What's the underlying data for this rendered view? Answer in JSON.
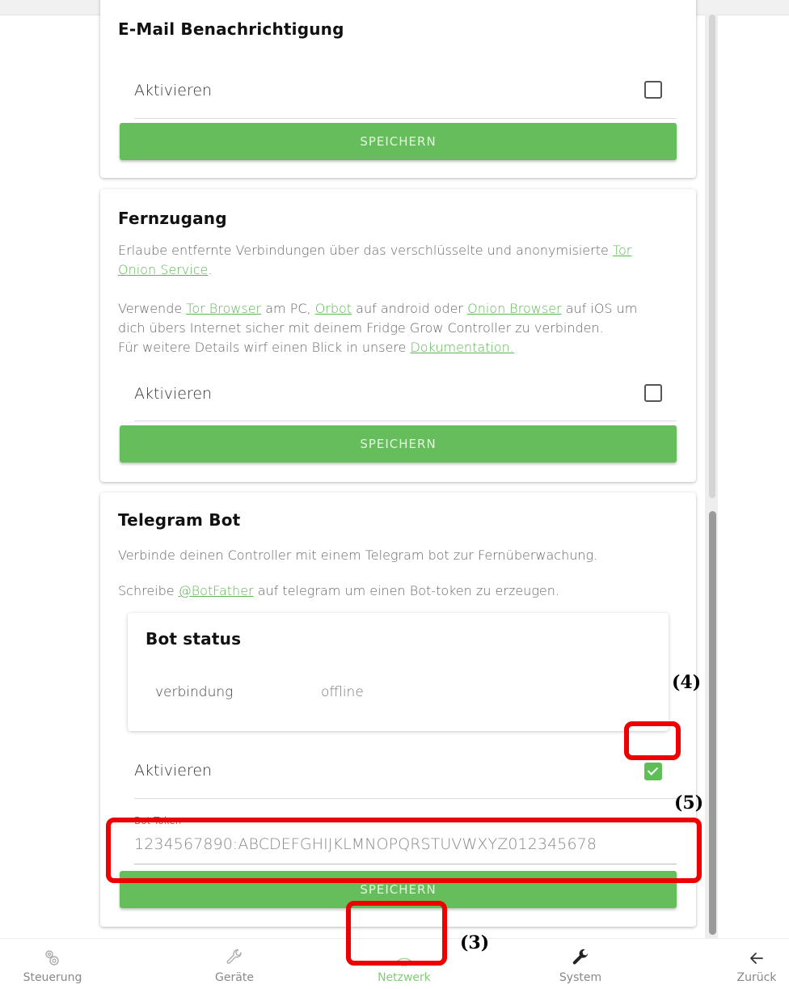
{
  "email_card": {
    "title": "E-Mail Benachrichtigung",
    "activate_label": "Aktivieren",
    "activate_checked": false,
    "save_label": "SPEICHERN"
  },
  "remote_card": {
    "title": "Fernzugang",
    "p1_text": "Erlaube entfernte Verbindungen über das verschlüsselte und anonymisierte ",
    "p1_link": "Tor Onion Service",
    "p1_end": ".",
    "p2_a": "Verwende ",
    "p2_link1": "Tor Browser",
    "p2_b": " am PC, ",
    "p2_link2": "Orbot",
    "p2_c": " auf android oder ",
    "p2_link3": "Onion Browser",
    "p2_d": " auf iOS um dich übers Internet sicher mit deinem Fridge Grow Controller zu verbinden.",
    "p3_text": "Für weitere Details wirf einen Blick in unsere ",
    "p3_link": "Dokumentation.",
    "activate_label": "Aktivieren",
    "activate_checked": false,
    "save_label": "SPEICHERN"
  },
  "telegram_card": {
    "title": "Telegram Bot",
    "p1": "Verbinde deinen Controller mit einem Telegram bot zur Fernüberwachung.",
    "p2_a": "Schreibe ",
    "p2_link": "@BotFather",
    "p2_b": " auf telegram um einen Bot-token zu erzeugen.",
    "status": {
      "title": "Bot status",
      "key": "verbindung",
      "value": "offline"
    },
    "activate_label": "Aktivieren",
    "activate_checked": true,
    "token_label": "Bot Token",
    "token_value": "1234567890:ABCDEFGHIJKLMNOPQRSTUVWXYZ012345678",
    "save_label": "SPEICHERN"
  },
  "annotations": {
    "a3": "(3)",
    "a4": "(4)",
    "a5": "(5)",
    "color": "#ee0000"
  },
  "nav": {
    "items": [
      {
        "label": "Steuerung",
        "icon": "gears-icon",
        "active": false
      },
      {
        "label": "Geräte",
        "icon": "wrench-outline-icon",
        "active": false
      },
      {
        "label": "Netzwerk",
        "icon": "wifi-icon",
        "active": true
      },
      {
        "label": "System",
        "icon": "wrench-icon",
        "active": false
      },
      {
        "label": "Zurück",
        "icon": "arrow-left-icon",
        "active": false
      }
    ],
    "active_color": "#7fce74"
  }
}
